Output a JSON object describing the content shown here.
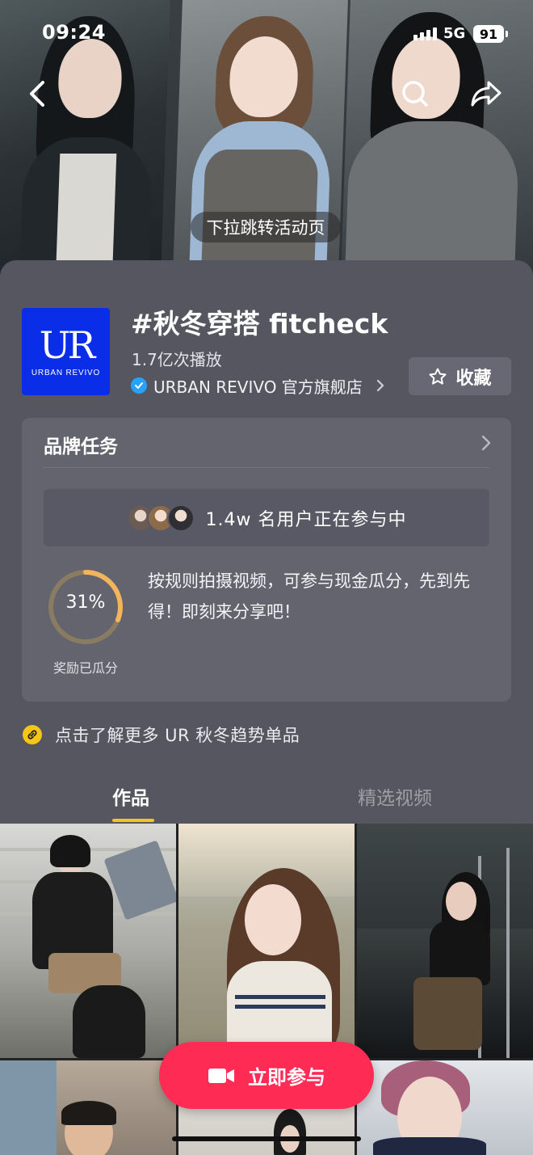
{
  "status_bar": {
    "time": "09:24",
    "network": "5G",
    "battery": "91"
  },
  "header": {
    "pull_hint": "下拉跳转活动页"
  },
  "topic": {
    "logo_mark": "UR",
    "logo_name": "URBAN REVIVO",
    "title": "#秋冬穿搭 fitcheck",
    "plays": "1.7亿次播放",
    "brand": "URBAN REVIVO 官方旗舰店",
    "favorite_label": "收藏"
  },
  "task": {
    "title": "品牌任务",
    "participants": "1.4w 名用户正在参与中",
    "progress_percent": 31,
    "progress_label": "31%",
    "progress_caption": "奖励已瓜分",
    "description": "按规则拍摄视频，可参与现金瓜分，先到先得！即刻来分享吧！"
  },
  "learn_more": "点击了解更多 UR 秋冬趋势单品",
  "tabs": [
    {
      "label": "作品",
      "active": true
    },
    {
      "label": "精选视频",
      "active": false
    }
  ],
  "join_button": "立即参与",
  "colors": {
    "accent": "#fe2c55",
    "tab_indicator": "#f5c518",
    "logo_bg": "#0a2de8",
    "progress": "#f2b55c"
  },
  "icons": [
    "back-icon",
    "search-icon",
    "share-icon",
    "verified-icon",
    "star-icon",
    "chevron-right-icon",
    "link-icon",
    "video-camera-icon"
  ]
}
